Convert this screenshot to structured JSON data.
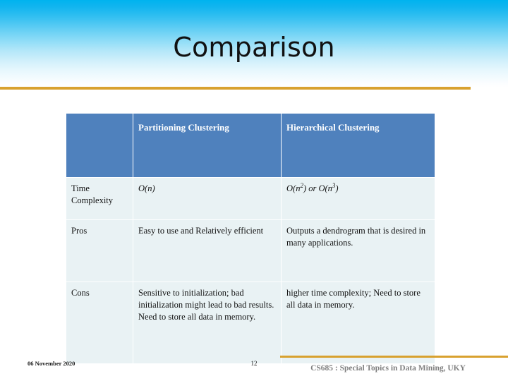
{
  "slide": {
    "title": "Comparison",
    "accent_gold": "#d8a12f",
    "header_blue": "#00b3ef",
    "table_header_blue": "#4f81bd",
    "cell_background": "#e9f2f4"
  },
  "table": {
    "headers": {
      "corner": "",
      "col1": "Partitioning Clustering",
      "col2": "Hierarchical Clustering"
    },
    "rows": [
      {
        "label": "Time Complexity",
        "partitioning": "O(n)",
        "partitioning_plain": "O(n)",
        "hierarchical_a": "O(n",
        "hierarchical_sup1": "2",
        "hierarchical_b": ") or O(n",
        "hierarchical_sup2": "3",
        "hierarchical_c": ")"
      },
      {
        "label": "Pros",
        "partitioning": "Easy to use and Relatively efficient",
        "hierarchical": "Outputs a dendrogram that is desired in many applications."
      },
      {
        "label": "Cons",
        "partitioning": "Sensitive to initialization; bad initialization might lead to bad results. Need to store all data in memory.",
        "hierarchical": "higher time complexity; Need to store all data in memory."
      }
    ]
  },
  "footer": {
    "date": "06 November 2020",
    "page_number": "12",
    "course": "CS685 : Special Topics in Data Mining, UKY"
  }
}
